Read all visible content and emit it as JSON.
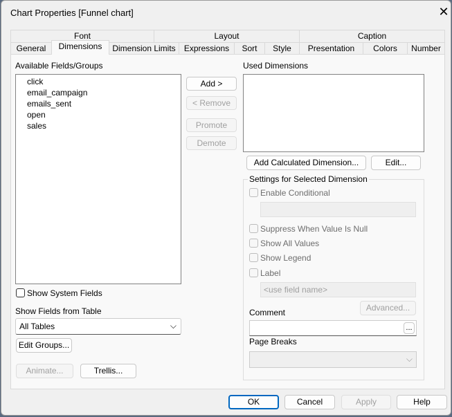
{
  "title": "Chart Properties [Funnel chart]",
  "tabs_row1": [
    "Font",
    "Layout",
    "Caption"
  ],
  "tabs_row2": [
    "General",
    "Dimensions",
    "Dimension Limits",
    "Expressions",
    "Sort",
    "Style",
    "Presentation",
    "Colors",
    "Number"
  ],
  "available": {
    "label": "Available Fields/Groups",
    "items": [
      "click",
      "email_campaign",
      "emails_sent",
      "open",
      "sales"
    ]
  },
  "buttons": {
    "add": "Add >",
    "remove": "< Remove",
    "promote": "Promote",
    "demote": "Demote",
    "add_calc": "Add Calculated Dimension...",
    "edit": "Edit...",
    "edit_groups": "Edit Groups...",
    "animate": "Animate...",
    "trellis": "Trellis...",
    "advanced": "Advanced...",
    "ellipsis": "...",
    "ok": "OK",
    "cancel": "Cancel",
    "apply": "Apply",
    "help": "Help"
  },
  "used": {
    "label": "Used Dimensions"
  },
  "show_system_fields": "Show System Fields",
  "show_fields_from_table": {
    "label": "Show Fields from Table",
    "value": "All Tables"
  },
  "settings": {
    "title": "Settings for Selected Dimension",
    "enable_conditional": "Enable Conditional",
    "suppress_null": "Suppress When Value Is Null",
    "show_all_values": "Show All Values",
    "show_legend": "Show Legend",
    "label": "Label",
    "label_placeholder": "<use field name>",
    "comment": "Comment",
    "page_breaks": "Page Breaks"
  }
}
